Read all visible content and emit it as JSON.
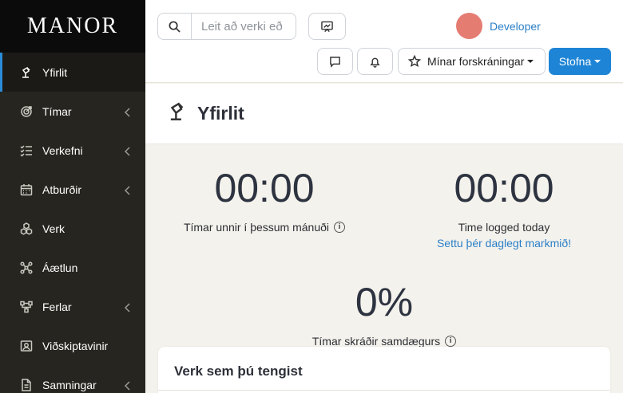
{
  "app": {
    "logo": "MANOR"
  },
  "sidebar": {
    "items": [
      {
        "label": "Yfirlit",
        "icon": "desk-lamp-icon",
        "active": true,
        "has_submenu": false
      },
      {
        "label": "Tímar",
        "icon": "target-icon",
        "active": false,
        "has_submenu": true
      },
      {
        "label": "Verkefni",
        "icon": "checklist-icon",
        "active": false,
        "has_submenu": true
      },
      {
        "label": "Atburðir",
        "icon": "calendar-icon",
        "active": false,
        "has_submenu": true
      },
      {
        "label": "Verk",
        "icon": "cubes-icon",
        "active": false,
        "has_submenu": false
      },
      {
        "label": "Áætlun",
        "icon": "workflow-icon",
        "active": false,
        "has_submenu": false
      },
      {
        "label": "Ferlar",
        "icon": "flow-icon",
        "active": false,
        "has_submenu": true
      },
      {
        "label": "Viðskiptavinir",
        "icon": "contact-card-icon",
        "active": false,
        "has_submenu": false
      },
      {
        "label": "Samningar",
        "icon": "document-icon",
        "active": false,
        "has_submenu": true
      }
    ]
  },
  "header": {
    "search_placeholder": "Leit að verki eð",
    "user_name": "Developer",
    "favorites_label": "Mínar forskráningar",
    "create_label": "Stofna"
  },
  "page": {
    "title": "Yfirlit"
  },
  "stats": {
    "month": {
      "value": "00:00",
      "label": "Tímar unnir í þessum mánuði"
    },
    "today": {
      "value": "00:00",
      "label": "Time logged today",
      "link": "Settu þér daglegt markmið!"
    },
    "same_day": {
      "value": "0%",
      "label": "Tímar skráðir samdægurs"
    }
  },
  "card": {
    "title": "Verk sem þú tengist"
  },
  "colors": {
    "accent": "#1e84d6",
    "sidebar_bg": "#26251f",
    "avatar": "#e57c72"
  }
}
